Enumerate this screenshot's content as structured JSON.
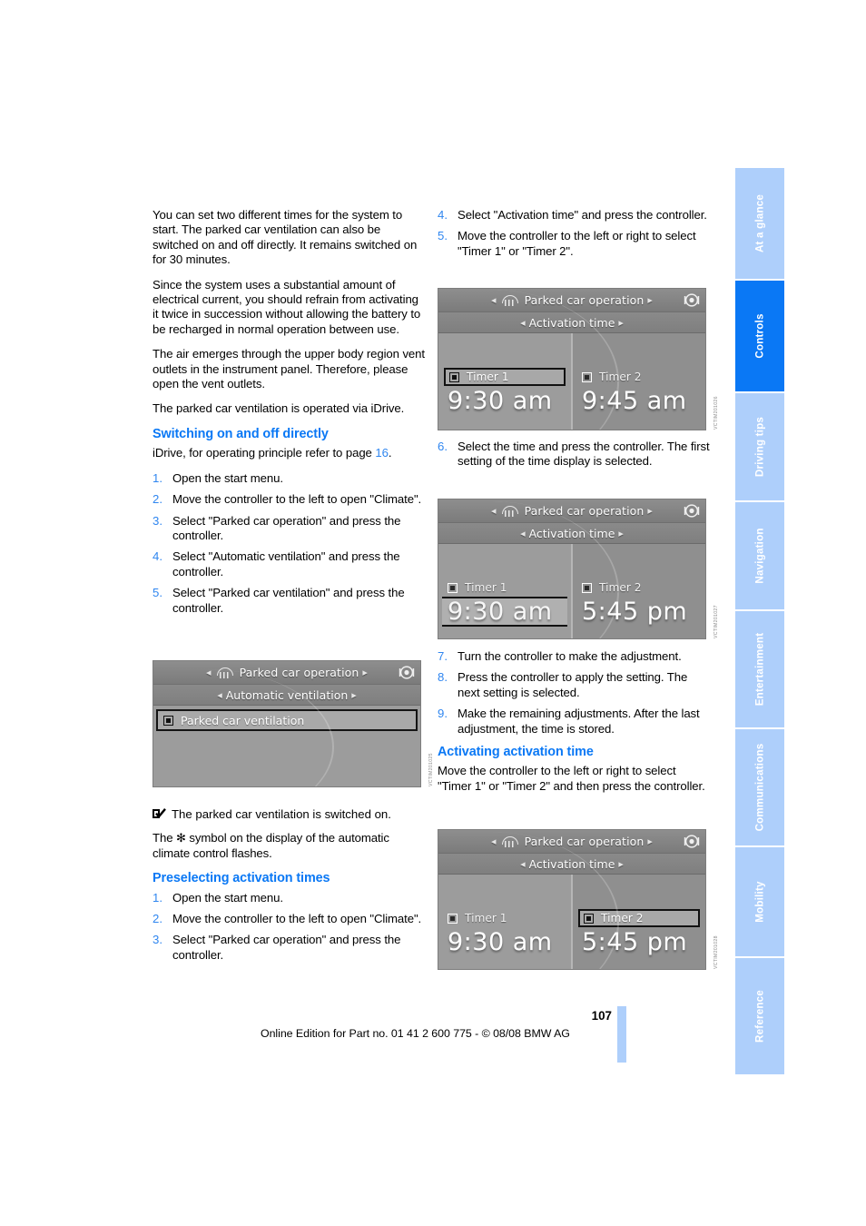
{
  "document": {
    "page_number": "107",
    "footer_text": "Online Edition for Part no. 01 41 2 600 775 - © 08/08 BMW AG"
  },
  "left_column": {
    "paragraphs": [
      "You can set two different times for the system to start. The parked car ventilation can also be switched on and off directly. It remains switched on for 30 minutes.",
      "Since the system uses a substantial amount of electrical current, you should refrain from activating it twice in succession without allowing the battery to be recharged in normal operation between use.",
      "The air emerges through the upper body region vent outlets in the instrument panel. Therefore, please open the vent outlets.",
      "The parked car ventilation is operated via iDrive."
    ],
    "section1": {
      "heading": "Switching on and off directly",
      "intro_prefix": "iDrive, for operating principle refer to page ",
      "intro_link": "16",
      "intro_suffix": ".",
      "steps": [
        {
          "num": "1.",
          "text": "Open the start menu."
        },
        {
          "num": "2.",
          "text": "Move the controller to the left to open \"Climate\"."
        },
        {
          "num": "3.",
          "text": "Select \"Parked car operation\" and press the controller."
        },
        {
          "num": "4.",
          "text": "Select \"Automatic ventilation\" and press the controller."
        },
        {
          "num": "5.",
          "text": "Select \"Parked car ventilation\" and press the controller."
        }
      ]
    },
    "note": {
      "icon": "checkbox-check-icon",
      "text": "The parked car ventilation is switched on.",
      "symbol_note_prefix": "The ",
      "symbol_glyph": "✻",
      "symbol_note_suffix": " symbol on the display of the automatic climate control flashes."
    },
    "section2": {
      "heading": "Preselecting activation times",
      "steps": [
        {
          "num": "1.",
          "text": "Open the start menu."
        },
        {
          "num": "2.",
          "text": "Move the controller to the left to open \"Climate\"."
        },
        {
          "num": "3.",
          "text": "Select \"Parked car operation\" and press the controller."
        }
      ]
    }
  },
  "right_column": {
    "steps_top": [
      {
        "num": "4.",
        "text": "Select \"Activation time\" and press the controller."
      },
      {
        "num": "5.",
        "text": "Move the controller to the left or right to select \"Timer 1\" or \"Timer 2\"."
      }
    ],
    "step6": {
      "num": "6.",
      "text": "Select the time and press the controller. The first setting of the time display is selected."
    },
    "steps_bottom": [
      {
        "num": "7.",
        "text": "Turn the controller to make the adjustment."
      },
      {
        "num": "8.",
        "text": "Press the controller to apply the setting. The next setting is selected."
      },
      {
        "num": "9.",
        "text": "Make the remaining adjustments. After the last adjustment, the time is stored."
      }
    ],
    "section3": {
      "heading": "Activating activation time",
      "paragraph": "Move the controller to the left or right to select \"Timer 1\" or \"Timer 2\" and then press the controller."
    }
  },
  "screenshots": {
    "shot1": {
      "title": "Parked car operation",
      "subtitle": "Automatic ventilation",
      "list_item": "Parked car ventilation",
      "code": "VCTIM201025"
    },
    "shot2": {
      "title": "Parked car operation",
      "subtitle": "Activation time",
      "timer1_label": "Timer 1",
      "timer1_time": "9:30 am",
      "timer2_label": "Timer 2",
      "timer2_time": "9:45 am",
      "code": "VCTIM201026"
    },
    "shot3": {
      "title": "Parked car operation",
      "subtitle": "Activation time",
      "timer1_label": "Timer 1",
      "timer1_time": "9:30 am",
      "timer2_label": "Timer 2",
      "timer2_time": "5:45 pm",
      "code": "VCTIM201027"
    },
    "shot4": {
      "title": "Parked car operation",
      "subtitle": "Activation time",
      "timer1_label": "Timer 1",
      "timer1_time": "9:30 am",
      "timer2_label": "Timer 2",
      "timer2_time": "5:45 pm",
      "code": "VCTIM201028"
    }
  },
  "sidebar": {
    "tabs": [
      {
        "label": "At a glance",
        "active": false
      },
      {
        "label": "Controls",
        "active": true
      },
      {
        "label": "Driving tips",
        "active": false
      },
      {
        "label": "Navigation",
        "active": false
      },
      {
        "label": "Entertainment",
        "active": false
      },
      {
        "label": "Communications",
        "active": false
      },
      {
        "label": "Mobility",
        "active": false
      },
      {
        "label": "Reference",
        "active": false
      }
    ]
  },
  "colors": {
    "accent_blue": "#0a78f5",
    "tab_inactive": "#aecffb",
    "heading_blue": "#0a78f5"
  }
}
